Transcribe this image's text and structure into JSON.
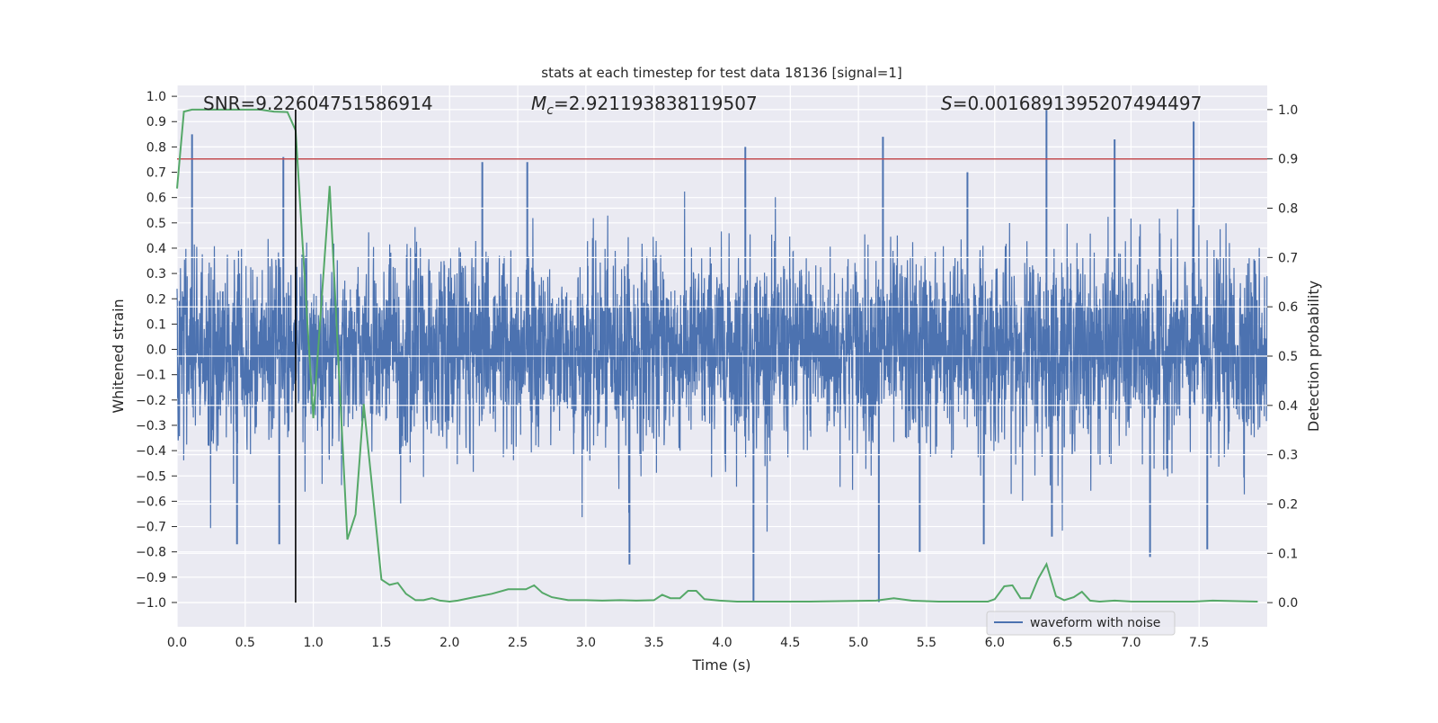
{
  "chart_data": {
    "type": "line",
    "title": "stats at each timestep for test data 18136 [signal=1]",
    "xlabel": "Time (s)",
    "ylabel": "Whitened strain",
    "ylabel_right": "Detection probability",
    "xlim": [
      0,
      8
    ],
    "ylim": [
      -1.096,
      1.043
    ],
    "ylim_right": [
      -0.049,
      1.049
    ],
    "xticks": [
      "0.0",
      "0.5",
      "1.0",
      "1.5",
      "2.0",
      "2.5",
      "3.0",
      "3.5",
      "4.0",
      "4.5",
      "5.0",
      "5.5",
      "6.0",
      "6.5",
      "7.0",
      "7.5"
    ],
    "yticks": [
      "1.0",
      "0.9",
      "0.8",
      "0.7",
      "0.6",
      "0.5",
      "0.4",
      "0.3",
      "0.2",
      "0.1",
      "0.0",
      "−0.1",
      "−0.2",
      "−0.3",
      "−0.4",
      "−0.5",
      "−0.6",
      "−0.7",
      "−0.8",
      "−0.9",
      "−1.0"
    ],
    "yticks_right": [
      "1.0",
      "0.9",
      "0.8",
      "0.7",
      "0.6",
      "0.5",
      "0.4",
      "0.3",
      "0.2",
      "0.1",
      "0.0"
    ],
    "grid": true,
    "legend": {
      "placement": "lower-right",
      "entries": [
        "waveform with noise"
      ]
    },
    "annotations": {
      "snr": "SNR=9.22604751586914",
      "mc_symbol": "M",
      "mc_sub": "c",
      "mc_value": "=2.921193838119507",
      "s_symbol": "S",
      "s_value": "=0.0016891395207494497"
    },
    "colors": {
      "background": "#eaeaf2",
      "waveform": "#4c72b0",
      "probability": "#55a868",
      "threshold": "#c44e52",
      "marker": "#000000"
    },
    "waveform": {
      "name": "waveform with noise",
      "typical_amplitude": 0.4,
      "notable_spikes": [
        [
          0.11,
          0.85
        ],
        [
          0.44,
          -0.77
        ],
        [
          0.75,
          -0.77
        ],
        [
          0.78,
          0.76
        ],
        [
          2.24,
          0.74
        ],
        [
          2.57,
          0.74
        ],
        [
          3.32,
          -0.85
        ],
        [
          4.17,
          0.8
        ],
        [
          4.23,
          -1.0
        ],
        [
          5.15,
          -1.0
        ],
        [
          5.18,
          0.84
        ],
        [
          5.45,
          -0.8
        ],
        [
          5.8,
          0.7
        ],
        [
          5.92,
          -0.77
        ],
        [
          6.38,
          0.95
        ],
        [
          6.42,
          -0.74
        ],
        [
          6.88,
          0.83
        ],
        [
          7.14,
          -0.82
        ],
        [
          7.46,
          0.9
        ],
        [
          7.56,
          -0.79
        ]
      ]
    },
    "threshold_right": 0.9,
    "marker_time": 0.87,
    "probability": [
      [
        0,
        0.84
      ],
      [
        0.05,
        0.996
      ],
      [
        0.11,
        1.0
      ],
      [
        0.61,
        1.0
      ],
      [
        0.71,
        0.996
      ],
      [
        0.81,
        0.995
      ],
      [
        0.87,
        0.958
      ],
      [
        1.0,
        0.374
      ],
      [
        1.12,
        0.845
      ],
      [
        1.25,
        0.128
      ],
      [
        1.31,
        0.179
      ],
      [
        1.37,
        0.403
      ],
      [
        1.5,
        0.047
      ],
      [
        1.56,
        0.036
      ],
      [
        1.62,
        0.04
      ],
      [
        1.68,
        0.018
      ],
      [
        1.75,
        0.005
      ],
      [
        1.81,
        0.005
      ],
      [
        1.87,
        0.009
      ],
      [
        1.93,
        0.004
      ],
      [
        2.0,
        0.002
      ],
      [
        2.06,
        0.004
      ],
      [
        2.18,
        0.011
      ],
      [
        2.31,
        0.018
      ],
      [
        2.43,
        0.027
      ],
      [
        2.56,
        0.027
      ],
      [
        2.62,
        0.035
      ],
      [
        2.68,
        0.02
      ],
      [
        2.75,
        0.011
      ],
      [
        2.87,
        0.005
      ],
      [
        3.0,
        0.005
      ],
      [
        3.12,
        0.004
      ],
      [
        3.25,
        0.005
      ],
      [
        3.37,
        0.004
      ],
      [
        3.5,
        0.005
      ],
      [
        3.56,
        0.016
      ],
      [
        3.62,
        0.009
      ],
      [
        3.69,
        0.009
      ],
      [
        3.75,
        0.024
      ],
      [
        3.81,
        0.024
      ],
      [
        3.87,
        0.007
      ],
      [
        3.98,
        0.004
      ],
      [
        4.11,
        0.002
      ],
      [
        4.64,
        0.002
      ],
      [
        5.13,
        0.004
      ],
      [
        5.26,
        0.009
      ],
      [
        5.39,
        0.004
      ],
      [
        5.59,
        0.002
      ],
      [
        5.95,
        0.002
      ],
      [
        6.0,
        0.007
      ],
      [
        6.07,
        0.033
      ],
      [
        6.13,
        0.035
      ],
      [
        6.19,
        0.009
      ],
      [
        6.26,
        0.009
      ],
      [
        6.32,
        0.049
      ],
      [
        6.38,
        0.078
      ],
      [
        6.45,
        0.013
      ],
      [
        6.51,
        0.005
      ],
      [
        6.58,
        0.011
      ],
      [
        6.64,
        0.022
      ],
      [
        6.7,
        0.004
      ],
      [
        6.77,
        0.002
      ],
      [
        6.88,
        0.004
      ],
      [
        7.01,
        0.002
      ],
      [
        7.46,
        0.002
      ],
      [
        7.6,
        0.004
      ],
      [
        7.93,
        0.002
      ]
    ]
  }
}
